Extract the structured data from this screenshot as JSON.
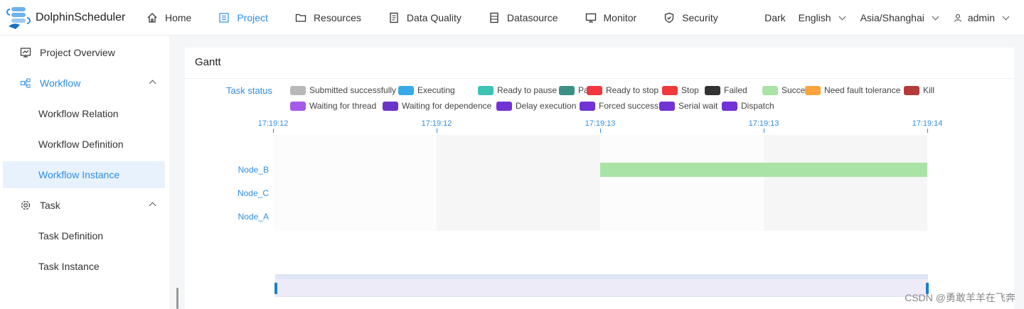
{
  "header": {
    "brand": "DolphinScheduler",
    "nav": [
      {
        "label": "Home",
        "icon": "home-icon"
      },
      {
        "label": "Project",
        "icon": "project-icon",
        "active": true
      },
      {
        "label": "Resources",
        "icon": "folder-icon"
      },
      {
        "label": "Data Quality",
        "icon": "data-quality-icon"
      },
      {
        "label": "Datasource",
        "icon": "datasource-icon"
      },
      {
        "label": "Monitor",
        "icon": "monitor-icon"
      },
      {
        "label": "Security",
        "icon": "shield-icon"
      }
    ],
    "theme": "Dark",
    "language": "English",
    "timezone": "Asia/Shanghai",
    "user": "admin"
  },
  "sidebar": {
    "items": [
      {
        "label": "Project Overview"
      },
      {
        "label": "Workflow"
      },
      {
        "label": "Workflow Relation"
      },
      {
        "label": "Workflow Definition"
      },
      {
        "label": "Workflow Instance"
      },
      {
        "label": "Task"
      },
      {
        "label": "Task Definition"
      },
      {
        "label": "Task Instance"
      }
    ]
  },
  "card": {
    "title": "Gantt",
    "legend_title": "Task status",
    "legend": [
      {
        "label": "Submitted successfully",
        "color": "#b8b8b8"
      },
      {
        "label": "Executing",
        "color": "#36a9e6"
      },
      {
        "label": "Ready to pause",
        "color": "#3ec3b5"
      },
      {
        "label": "Pause",
        "color": "#3b9185"
      },
      {
        "label": "Ready to stop",
        "color": "#f0383e"
      },
      {
        "label": "Stop",
        "color": "#ee3a3a"
      },
      {
        "label": "Failed",
        "color": "#333333"
      },
      {
        "label": "Success",
        "color": "#a9e3a5"
      },
      {
        "label": "Need fault tolerance",
        "color": "#fca43b"
      },
      {
        "label": "Kill",
        "color": "#b53a3a"
      },
      {
        "label": "Waiting for thread",
        "color": "#a65ae8"
      },
      {
        "label": "Waiting for dependence",
        "color": "#6b34c8"
      },
      {
        "label": "Delay execution",
        "color": "#7132d6"
      },
      {
        "label": "Forced success",
        "color": "#7132d6"
      },
      {
        "label": "Serial wait",
        "color": "#7132d6"
      },
      {
        "label": "Dispatch",
        "color": "#7132d6"
      }
    ]
  },
  "chart_data": {
    "type": "gantt",
    "x_ticks": [
      "17:19:12",
      "17:19:12",
      "17:19:13",
      "17:19:13",
      "17:19:14"
    ],
    "rows": [
      "Node_B",
      "Node_C",
      "Node_A"
    ],
    "tasks": [
      {
        "name": "Node_B",
        "start_tick": 2,
        "end_tick": 4,
        "status": "Success"
      }
    ]
  },
  "watermark": "CSDN @勇敢羊羊在飞奔"
}
